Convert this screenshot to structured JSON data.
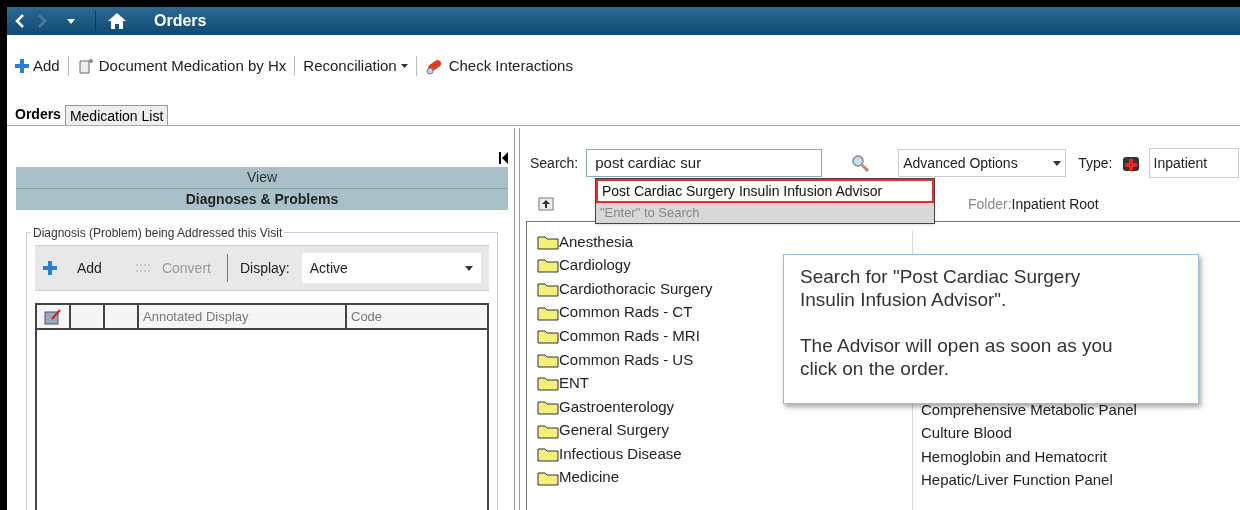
{
  "title_bar": {
    "title": "Orders"
  },
  "toolbar": [
    {
      "kind": "add",
      "label": "Add"
    },
    {
      "kind": "document",
      "label": "Document Medication by Hx"
    },
    {
      "kind": "menu",
      "label": "Reconciliation"
    },
    {
      "kind": "interactions",
      "label": "Check Interactions"
    }
  ],
  "tabs": [
    {
      "label": "Orders",
      "selected": true
    },
    {
      "label": "Medication List",
      "selected": false
    }
  ],
  "left_panel": {
    "view_header": "View",
    "section_header": "Diagnoses & Problems",
    "group_title": "Diagnosis (Problem) being Addressed this Visit",
    "add_button": "Add",
    "convert_button": {
      "label": "Convert",
      "disabled": true
    },
    "display_label": "Display:",
    "display_value": "Active",
    "table": {
      "columns": [
        "Annotated Display",
        "Code"
      ]
    }
  },
  "search": {
    "label": "Search:",
    "value": "post cardiac sur",
    "advanced_options": "Advanced Options",
    "type_label": "Type:",
    "type_value": "Inpatient",
    "suggestions": [
      {
        "label": "Post Cardiac Surgery Insulin Infusion Advisor",
        "selected": true
      },
      {
        "label": "\"Enter\" to Search",
        "selected": false
      }
    ]
  },
  "folder_bar": {
    "label": "Folder:",
    "value": "Inpatient Root"
  },
  "folders": [
    "Anesthesia",
    "Cardiology",
    "Cardiothoracic Surgery",
    "Common Rads - CT",
    "Common Rads - MRI",
    "Common Rads - US",
    "ENT",
    "Gastroenterology",
    "General Surgery",
    "Infectious Disease",
    "Medicine"
  ],
  "orders": [
    "Comprehensive Metabolic Panel",
    "Culture Blood",
    "Hemoglobin and Hematocrit",
    "Hepatic/Liver Function Panel"
  ],
  "callout": {
    "lines": [
      "Search for \"Post Cardiac Surgery Insulin Infusion Advisor\".",
      "The Advisor will open as soon as you click on the order."
    ]
  }
}
